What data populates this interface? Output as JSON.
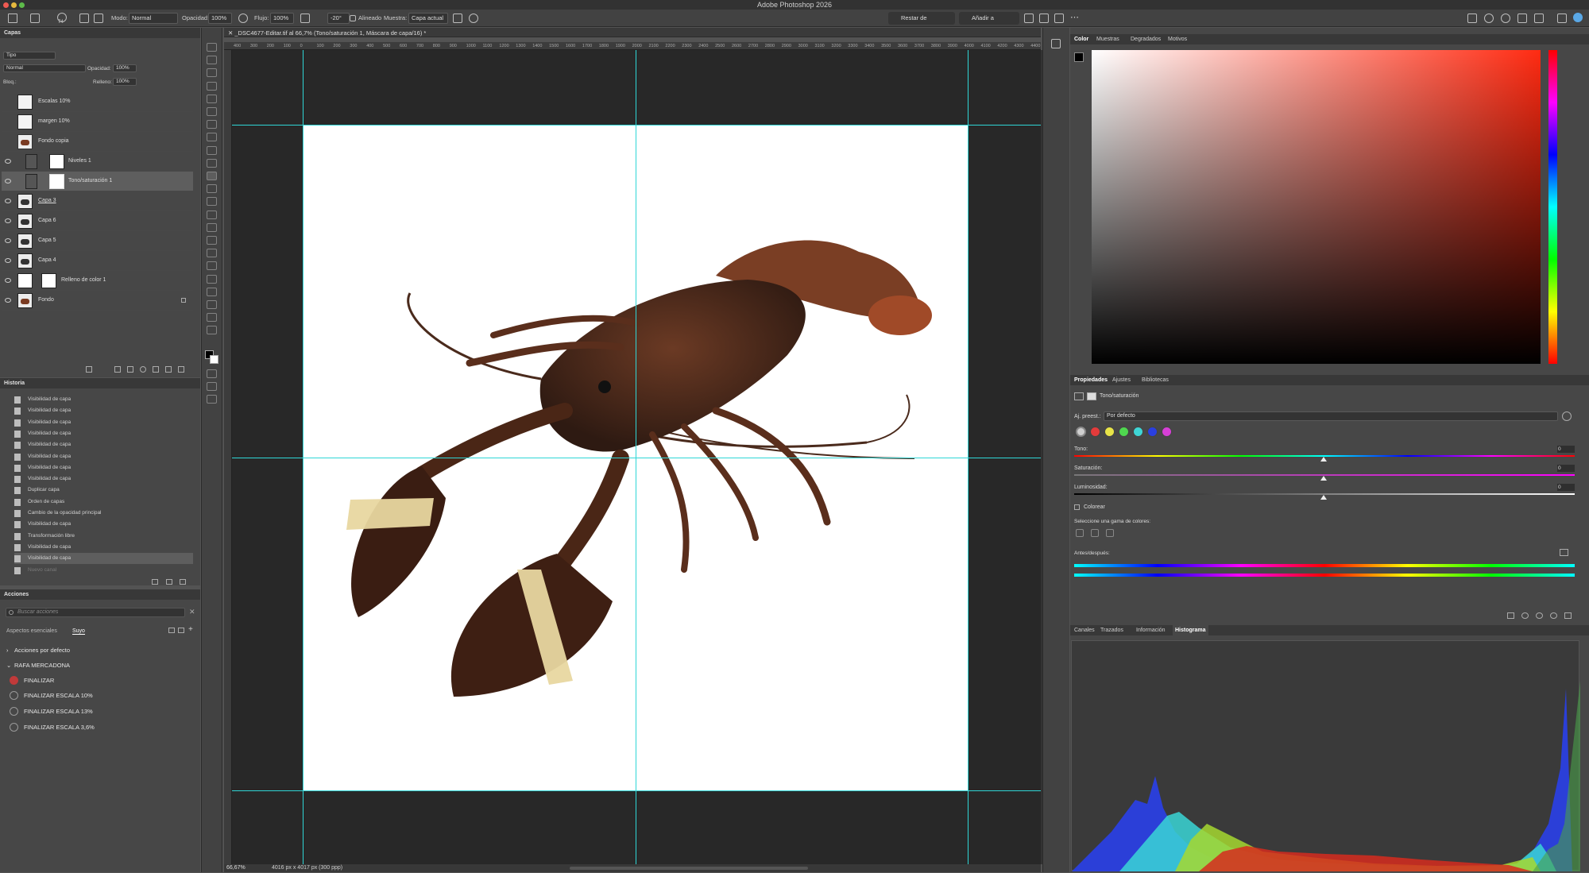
{
  "app": {
    "title": "Adobe Photoshop 2026"
  },
  "options": {
    "brush_size": "74",
    "mode_label": "Modo:",
    "mode_value": "Normal",
    "opacity_label": "Opacidad:",
    "opacity_value": "100%",
    "flow_label": "Flujo:",
    "flow_value": "100%",
    "angle_value": "-20°",
    "aligned_label": "Alineado",
    "sample_label": "Muestra:",
    "sample_value": "Capa actual",
    "subtract_mask": "Restar de máscara",
    "add_mask": "Añadir a máscara"
  },
  "layers_panel": {
    "tab": "Capas",
    "filter": "Tipo",
    "blend": "Normal",
    "opacity_label": "Opacidad:",
    "opacity_value": "100%",
    "lock_label": "Bloq.:",
    "fill_label": "Relleno:",
    "fill_value": "100%",
    "layers": [
      "Escalas 10%",
      "margen 10%",
      "Fondo copia",
      "Niveles 1",
      "Tono/saturación 1",
      "Capa 3",
      "Capa 6",
      "Capa 5",
      "Capa 4",
      "Relleno de color 1",
      "Fondo"
    ]
  },
  "history_panel": {
    "tab": "Historia",
    "items": [
      "Visibilidad de capa",
      "Visibilidad de capa",
      "Visibilidad de capa",
      "Visibilidad de capa",
      "Visibilidad de capa",
      "Visibilidad de capa",
      "Visibilidad de capa",
      "Visibilidad de capa",
      "Duplicar capa",
      "Orden de capas",
      "Cambio de la opacidad principal",
      "Visibilidad de capa",
      "Transformación libre",
      "Visibilidad de capa",
      "Visibilidad de capa",
      "Nuevo canal"
    ]
  },
  "actions_panel": {
    "tab": "Acciones",
    "search_placeholder": "Buscar acciones",
    "sub_tabs": [
      "Aspectos esenciales",
      "Suyo"
    ],
    "sets": [
      "Acciones por defecto",
      "RAFA MERCADONA"
    ],
    "actions": [
      "FINALIZAR",
      "FINALIZAR ESCALA 10%",
      "FINALIZAR ESCALA 13%",
      "FINALIZAR ESCALA 3,6%"
    ]
  },
  "document": {
    "tab": "_DSC4677-Editar.tif al 66,7% (Tono/saturación 1, Máscara de capa/16) *",
    "ruler": [
      "400",
      "300",
      "200",
      "100",
      "0",
      "100",
      "200",
      "300",
      "400",
      "500",
      "600",
      "700",
      "800",
      "900",
      "1000",
      "1100",
      "1200",
      "1300",
      "1400",
      "1500",
      "1600",
      "1700",
      "1800",
      "1900",
      "2000",
      "2100",
      "2200",
      "2300",
      "2400",
      "2500",
      "2600",
      "2700",
      "2800",
      "2900",
      "3000",
      "3100",
      "3200",
      "3300",
      "3400",
      "3500",
      "3600",
      "3700",
      "3800",
      "3900",
      "4000",
      "4100",
      "4200",
      "4300",
      "4400"
    ],
    "zoom": "66,67%",
    "info": "4016 px x 4017 px (300 ppp)"
  },
  "color_panel": {
    "tabs": [
      "Color",
      "Muestras",
      "Degradados",
      "Motivos"
    ]
  },
  "properties_panel": {
    "tabs": [
      "Propiedades",
      "Ajustes",
      "Bibliotecas"
    ],
    "adj_name": "Tono/saturación",
    "preset_label": "Aj. preest.:",
    "preset_value": "Por defecto",
    "hue_label": "Tono:",
    "hue_value": "0",
    "sat_label": "Saturación:",
    "sat_value": "0",
    "light_label": "Luminosidad:",
    "light_value": "0",
    "colorize_label": "Colorear",
    "range_label": "Seleccione una gama de colores:",
    "before_after_label": "Antes/después:",
    "swatches": [
      "#cfcfcf",
      "#e33b3b",
      "#e8e448",
      "#4fd84f",
      "#3fd6d6",
      "#2a3fe0",
      "#d63fd6"
    ]
  },
  "histogram_panel": {
    "tabs": [
      "Canales",
      "Trazados",
      "Información",
      "Histograma"
    ]
  }
}
